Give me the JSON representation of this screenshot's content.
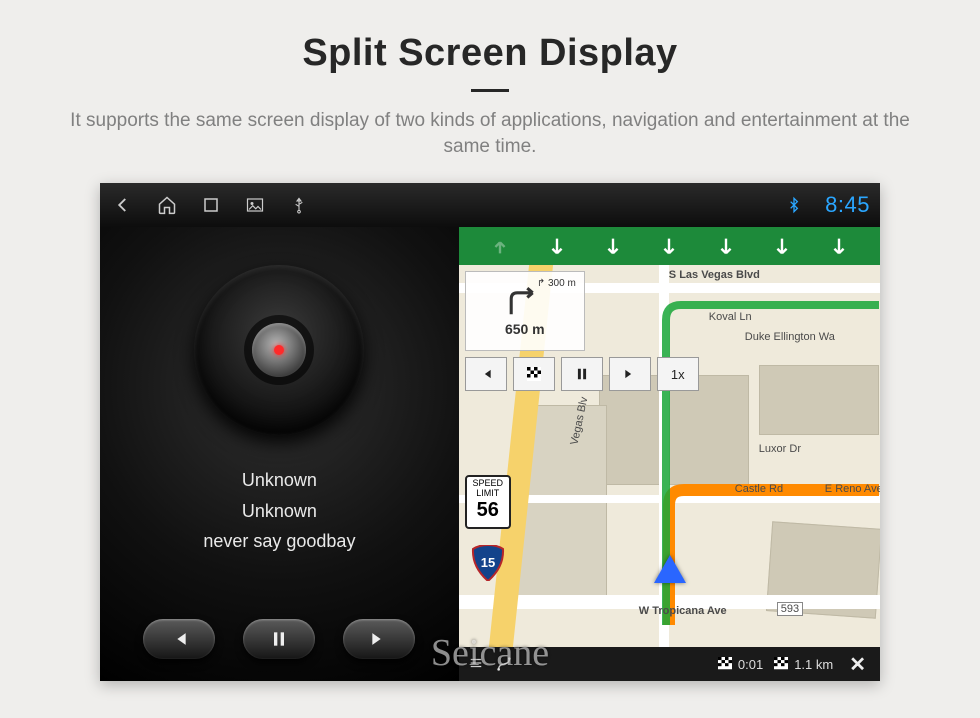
{
  "hero": {
    "title": "Split Screen Display",
    "subtitle": "It supports the same screen display of two kinds of applications, navigation and entertainment at the same time."
  },
  "statusbar": {
    "clock": "8:45"
  },
  "player": {
    "artist": "Unknown",
    "album": "Unknown",
    "track": "never say goodbay"
  },
  "nav": {
    "turn_distance_sub": "300 m",
    "turn_distance_main": "650 m",
    "sim_speed": "1x",
    "speed_limit_label": "SPEED LIMIT",
    "speed_limit_value": "56",
    "highway_shield": "15",
    "streets": {
      "s_las_vegas": "S Las Vegas Blvd",
      "koval": "Koval Ln",
      "duke": "Duke Ellington Wa",
      "vegas_blv": "Vegas Blv",
      "luxor": "Luxor Dr",
      "castle": "Castle Rd",
      "reno": "E Reno Ave",
      "tropicana": "W Tropicana Ave",
      "tropicana_exit": "593"
    },
    "bottom": {
      "time": "0:01",
      "dist": "1.1 km"
    }
  },
  "watermark": "Seicane"
}
